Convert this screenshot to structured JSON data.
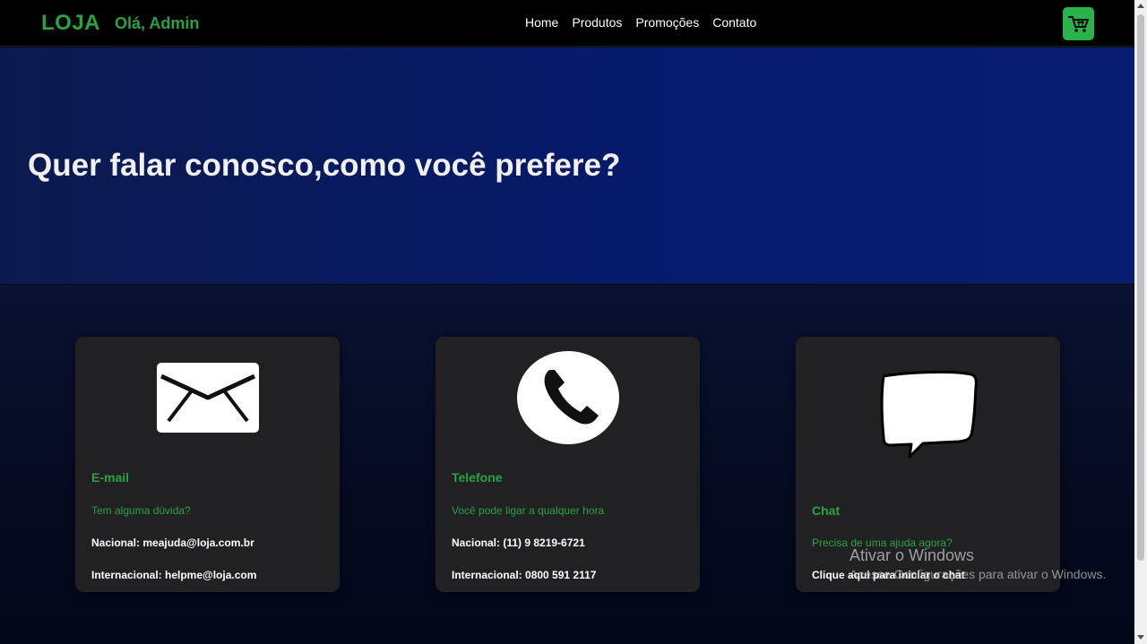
{
  "header": {
    "logo": "LOJA",
    "greeting": "Olá, Admin",
    "nav": [
      "Home",
      "Produtos",
      "Promoções",
      "Contato"
    ],
    "cart_icon": "cart-icon"
  },
  "hero": {
    "title": "Quer falar conosco,como você prefere?"
  },
  "cards": [
    {
      "icon": "envelope-icon",
      "title": "E-mail",
      "subtitle": "Tem alguma dúvida?",
      "line1": "Nacional: meajuda@loja.com.br",
      "line2": "Internacional: helpme@loja.com"
    },
    {
      "icon": "phone-icon",
      "title": "Telefone",
      "subtitle": "Você pode ligar a qualquer hora",
      "line1": "Nacional: (11) 9 8219-6721",
      "line2": "Internacional: 0800 591 2117"
    },
    {
      "icon": "chat-bubble-icon",
      "title": "Chat",
      "subtitle": "Precisa de uma ajuda agora?",
      "link": "Clique aqui para iniciar o chat"
    }
  ],
  "watermark": {
    "title": "Ativar o Windows",
    "subtitle": "Acesse Configurações para ativar o Windows."
  },
  "colors": {
    "accent": "#26a442",
    "cart_button": "#2ab34a",
    "hero_bg": "#061a6e",
    "card_bg": "#212123"
  }
}
